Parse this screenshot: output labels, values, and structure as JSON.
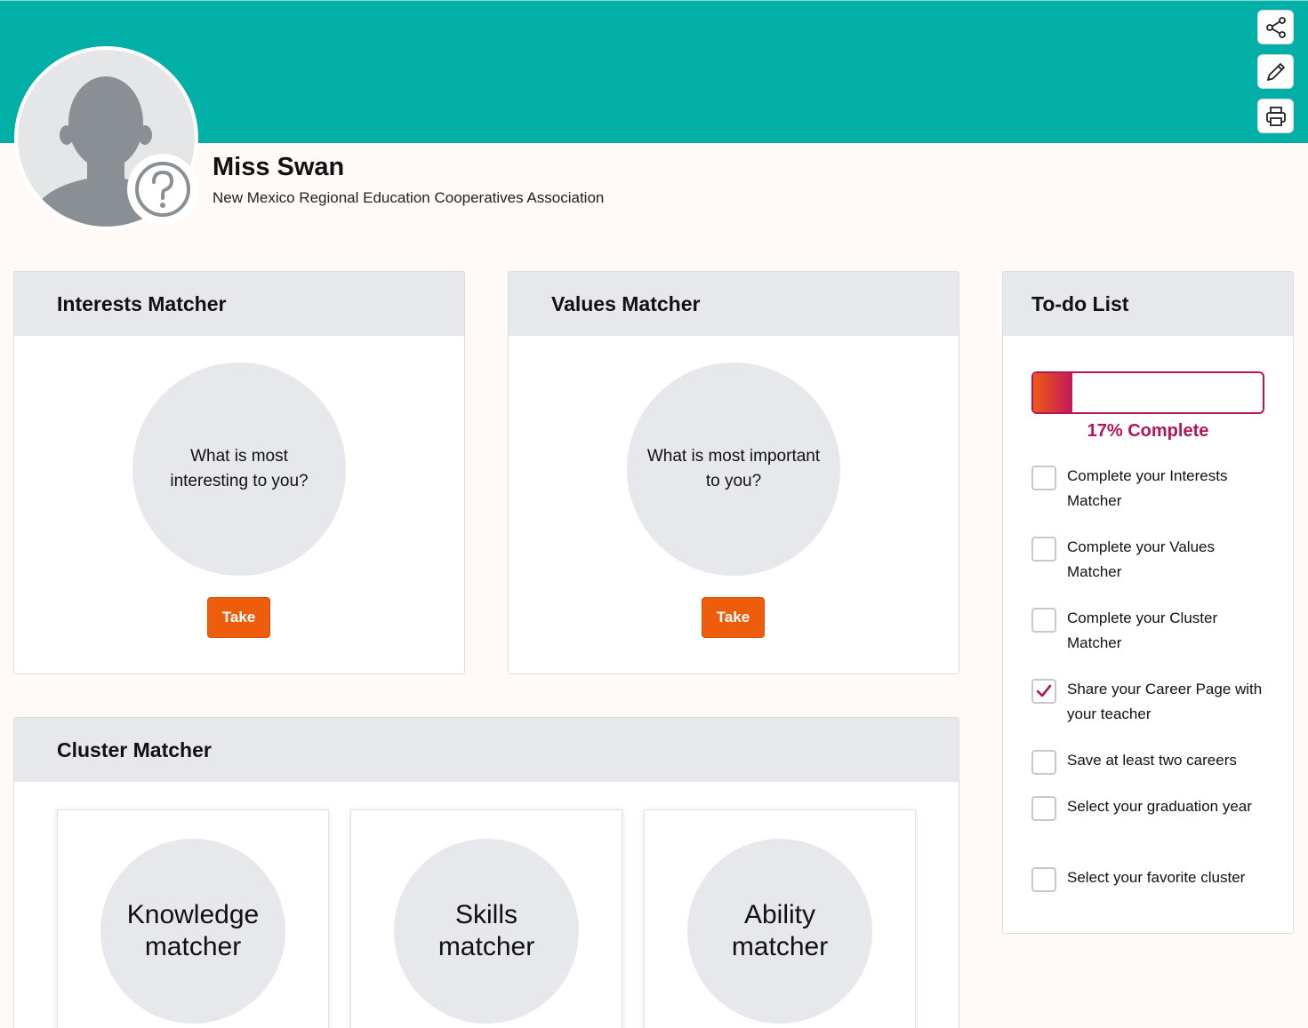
{
  "colors": {
    "banner": "#00afa5",
    "accent_orange": "#ee5d0c",
    "progress_magenta": "#b5135a",
    "card_header": "#e7e8eb",
    "page_bg": "#fffaf8"
  },
  "toolbar": {
    "share_icon": "share-icon",
    "edit_icon": "pencil-icon",
    "print_icon": "printer-icon"
  },
  "profile": {
    "name": "Miss Swan",
    "organization": "New Mexico Regional Education Cooperatives Association",
    "avatar_icon": "person-silhouette-icon",
    "badge_icon": "question-mark-icon"
  },
  "interests": {
    "title": "Interests Matcher",
    "prompt": "What is most interesting to you?",
    "button": "Take"
  },
  "values": {
    "title": "Values Matcher",
    "prompt": "What is most important to you?",
    "button": "Take"
  },
  "cluster": {
    "title": "Cluster Matcher",
    "items": [
      {
        "label": "Knowledge matcher"
      },
      {
        "label": "Skills matcher"
      },
      {
        "label": "Ability matcher"
      }
    ]
  },
  "todo": {
    "title": "To-do List",
    "progress_percent": 17,
    "progress_label": "17% Complete",
    "items": [
      {
        "label": "Complete your Interests Matcher",
        "checked": false
      },
      {
        "label": "Complete your Values Matcher",
        "checked": false
      },
      {
        "label": "Complete your Cluster Matcher",
        "checked": false
      },
      {
        "label": "Share your Career Page with your teacher",
        "checked": true
      },
      {
        "label": "Save at least two careers",
        "checked": false
      },
      {
        "label": "Select your graduation year",
        "checked": false
      },
      {
        "label": "Select your favorite cluster",
        "checked": false
      }
    ]
  }
}
